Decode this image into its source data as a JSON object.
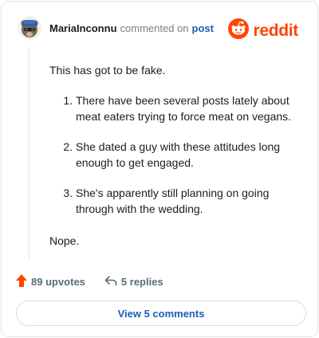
{
  "header": {
    "username": "MariaInconnu",
    "action_text": "commented on",
    "post_link": "post",
    "logo_text": "reddit"
  },
  "comment": {
    "intro": "This has got to be fake.",
    "items": [
      "There have been several posts lately about meat eaters trying to force meat on vegans.",
      "She dated a guy with these attitudes long enough to get engaged.",
      "She's apparently still planning on going through with the wedding."
    ],
    "outro": "Nope."
  },
  "footer": {
    "upvotes": "89 upvotes",
    "replies": "5 replies"
  },
  "view_button": "View 5 comments",
  "colors": {
    "brand": "#ff4500",
    "link": "#1a5fb4",
    "upvote_arrow": "#ff4500",
    "muted": "#576f76"
  },
  "icons": {
    "avatar": "bear-avatar-icon",
    "logo": "reddit-snoo-icon",
    "upvote": "upvote-arrow-icon",
    "reply": "reply-arrow-icon"
  }
}
